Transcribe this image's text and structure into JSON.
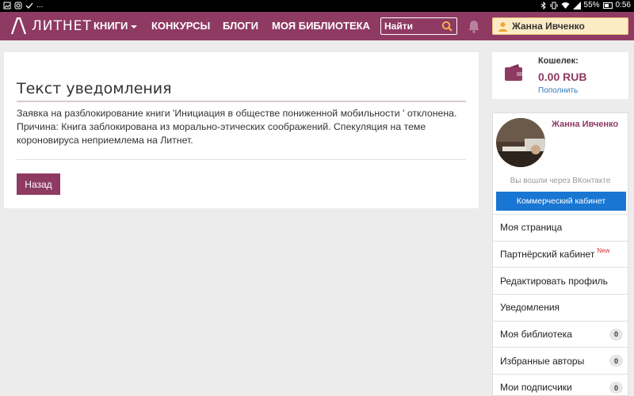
{
  "statusbar": {
    "left_icons": [
      "image-icon",
      "instagram-icon",
      "check-icon"
    ],
    "ellipsis": "...",
    "battery": "55%",
    "time": "0:56"
  },
  "navbar": {
    "logo_text": "ЛИТНЕТ",
    "items": [
      "КНИГИ",
      "КОНКУРСЫ",
      "БЛОГИ",
      "МОЯ БИБЛИОТЕКА"
    ],
    "search_placeholder": "Найти",
    "user_name": "Жанна Ивченко",
    "color": "#8e3a63"
  },
  "main": {
    "title": "Текст уведомления",
    "text": "Заявка на разблокирование книги 'Инициация в обществе пониженной мобильности ' отклонена. Причина: Книга заблокирована из морально-этических соображений. Спекуляция на теме короновируса неприемлема на Литнет.",
    "back_label": "Назад"
  },
  "wallet": {
    "label": "Кошелек:",
    "amount": "0.00 RUB",
    "topup": "Пополнить"
  },
  "user_card": {
    "name": "Жанна Ивченко",
    "vk_note": "Вы вошли через ВКонтакте",
    "commerce_label": "Коммерческий кабинет",
    "menu": [
      {
        "label": "Моя страница"
      },
      {
        "label": "Партнёрский кабинет",
        "tag": "New"
      },
      {
        "label": "Редактировать профиль"
      },
      {
        "label": "Уведомления"
      },
      {
        "label": "Моя библиотека",
        "count": "0"
      },
      {
        "label": "Избранные авторы",
        "count": "0"
      },
      {
        "label": "Мои подписчики",
        "count": "0"
      }
    ]
  }
}
